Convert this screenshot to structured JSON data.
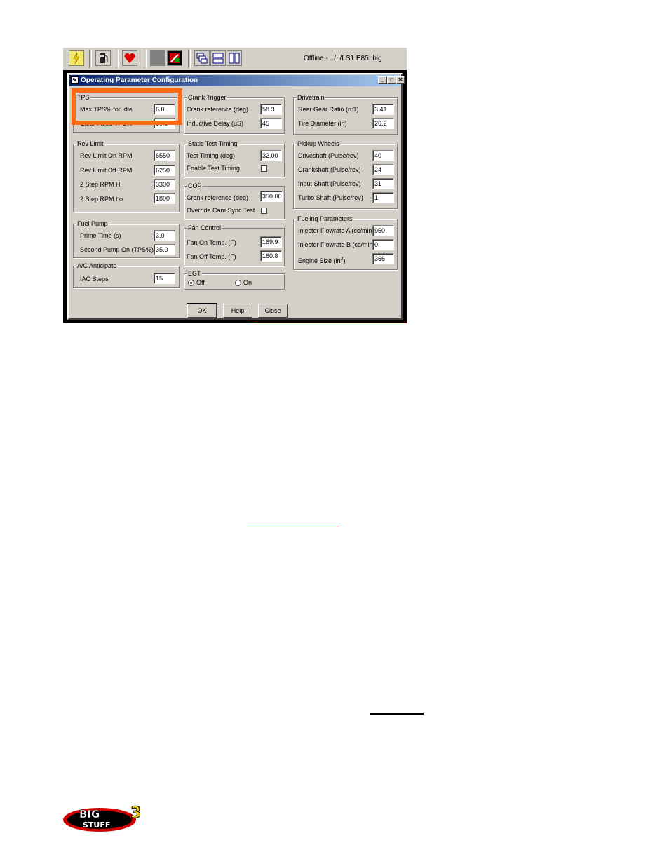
{
  "toolbar": {
    "status": "Offline - ../../LS1 E85. big",
    "icons": [
      "lightning-icon",
      "fuel-pump-icon",
      "heart-icon",
      "gray-square-icon",
      "ecu-icon",
      "cascade-windows-icon",
      "tile-horizontal-icon",
      "tile-vertical-icon"
    ]
  },
  "dialog": {
    "title": "Operating Parameter Configuration",
    "buttons": {
      "ok": "OK",
      "help": "Help",
      "close": "Close"
    },
    "tps": {
      "title": "TPS",
      "max_tps_label": "Max TPS% for Idle",
      "max_tps_value": "6.0",
      "clear_flood_label": "Clear Flood TPS%",
      "clear_flood_value": "80.0"
    },
    "rev_limit": {
      "title": "Rev Limit",
      "on_label": "Rev Limit On RPM",
      "on_value": "6550",
      "off_label": "Rev Limit Off RPM",
      "off_value": "6250",
      "hi_label": "2 Step RPM Hi",
      "hi_value": "3300",
      "lo_label": "2 Step RPM Lo",
      "lo_value": "1800"
    },
    "fuel_pump": {
      "title": "Fuel Pump",
      "prime_label": "Prime Time (s)",
      "prime_value": "3.0",
      "second_label": "Second Pump On (TPS%)",
      "second_value": "35.0"
    },
    "ac": {
      "title": "A/C Anticipate",
      "iac_label": "IAC Steps",
      "iac_value": "15"
    },
    "crank_trigger": {
      "title": "Crank Trigger",
      "ref_label": "Crank reference (deg)",
      "ref_value": "58.3",
      "delay_label": "Inductive Delay (uS)",
      "delay_value": "45"
    },
    "static_timing": {
      "title": "Static Test Timing",
      "test_label": "Test Timing (deg)",
      "test_value": "32.00",
      "enable_label": "Enable Test Timing"
    },
    "cop": {
      "title": "COP",
      "ref_label": "Crank reference (deg)",
      "ref_value": "350.00",
      "override_label": "Override Cam Sync Test"
    },
    "fan": {
      "title": "Fan Control",
      "on_label": "Fan On Temp. (F)",
      "on_value": "169.9",
      "off_label": "Fan Off Temp. (F)",
      "off_value": "160.8"
    },
    "egt": {
      "title": "EGT",
      "off_label": "Off",
      "on_label": "On"
    },
    "drivetrain": {
      "title": "Drivetrain",
      "gear_label": "Rear Gear Ratio (n:1)",
      "gear_value": "3.41",
      "tire_label": "Tire Diameter (in)",
      "tire_value": "26.2"
    },
    "pickup": {
      "title": "Pickup Wheels",
      "drive_label": "Driveshaft (Pulse/rev)",
      "drive_value": "40",
      "crank_label": "Crankshaft (Pulse/rev)",
      "crank_value": "24",
      "input_label": "Input Shaft (Pulse/rev)",
      "input_value": "31",
      "turbo_label": "Turbo Shaft (Pulse/rev)",
      "turbo_value": "1"
    },
    "fueling": {
      "title": "Fueling Parameters",
      "inj_a_label": "Injector Flowrate A (cc/min)",
      "inj_a_value": "950",
      "inj_b_label": "Injector Flowrate B (cc/min)",
      "inj_b_value": "0",
      "engine_label": "Engine Size (in",
      "engine_sup": "3",
      "engine_close": ")",
      "engine_value": "366"
    }
  },
  "highlight_color": "#ff6a14",
  "logo": {
    "text": "BIG STUFF 3"
  }
}
